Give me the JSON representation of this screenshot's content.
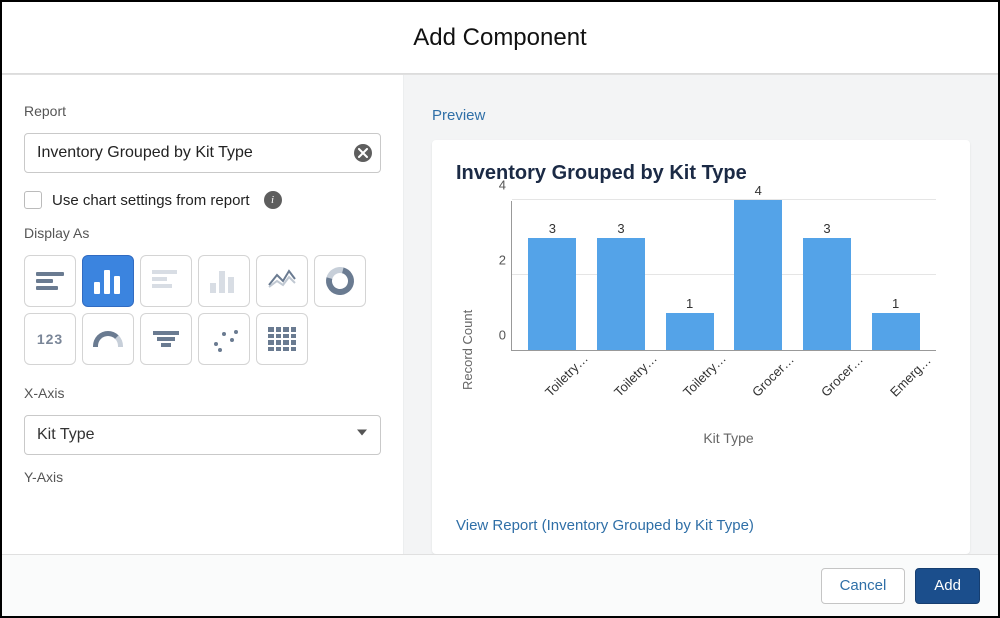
{
  "modal": {
    "title": "Add Component"
  },
  "left": {
    "report_label": "Report",
    "report_value": "Inventory Grouped by Kit Type",
    "use_chart_settings_label": "Use chart settings from report",
    "display_as_label": "Display As",
    "xaxis_label": "X-Axis",
    "xaxis_value": "Kit Type",
    "yaxis_label": "Y-Axis"
  },
  "preview": {
    "section_label": "Preview",
    "title": "Inventory Grouped by Kit Type",
    "view_report_link": "View Report (Inventory Grouped by Kit Type)"
  },
  "chart_data": {
    "type": "bar",
    "categories": [
      "Toiletry…",
      "Toiletry…",
      "Toiletry…",
      "Grocer…",
      "Grocer…",
      "Emerg…"
    ],
    "values": [
      3,
      3,
      1,
      4,
      3,
      1
    ],
    "title": "Inventory Grouped by Kit Type",
    "xlabel": "Kit Type",
    "ylabel": "Record Count",
    "ylim": [
      0,
      4
    ],
    "yticks": [
      0,
      2,
      4
    ]
  },
  "footer": {
    "cancel": "Cancel",
    "add": "Add"
  }
}
